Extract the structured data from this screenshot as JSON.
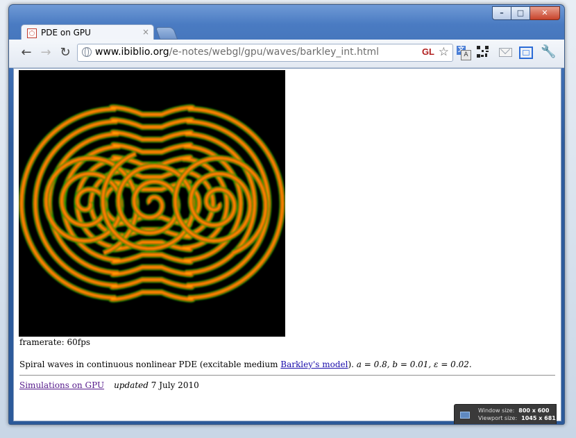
{
  "browser": {
    "tab_title": "PDE on GPU",
    "tab_close": "×",
    "window_controls": {
      "minimize": "–",
      "maximize": "□",
      "close": "✕"
    },
    "nav": {
      "back": "←",
      "forward": "→",
      "reload": "↻"
    },
    "url_domain": "www.ibiblio.org",
    "url_path": "/e-notes/webgl/gpu/waves/barkley_int.html",
    "gl_badge": "GL",
    "star": "☆",
    "wrench": "🔧",
    "extensions": [
      "translate-icon",
      "qr-code-icon",
      "mail-icon",
      "fullscreen-icon",
      "wrench-icon"
    ]
  },
  "page": {
    "framerate": "framerate: 60fps",
    "description_text": "Spiral waves in continuous nonlinear PDE (excitable medium ",
    "description_link": "Barkley's model",
    "description_close": ").",
    "params": "a = 0.8, b = 0.01, ε = 0.02.",
    "footer_link": "Simulations on GPU",
    "updated_label": "updated",
    "updated_date": "7 July 2010"
  },
  "size_badge": {
    "window_label": "Window size:",
    "window_value": "800 x 600",
    "viewport_label": "Viewport size:",
    "viewport_value": "1045 x 681"
  },
  "colors": {
    "wave_orange": "#ff9a00",
    "wave_red": "#e23000",
    "wave_green": "#1fa300",
    "link": "#1a0dab",
    "visited_link": "#551a8b"
  }
}
